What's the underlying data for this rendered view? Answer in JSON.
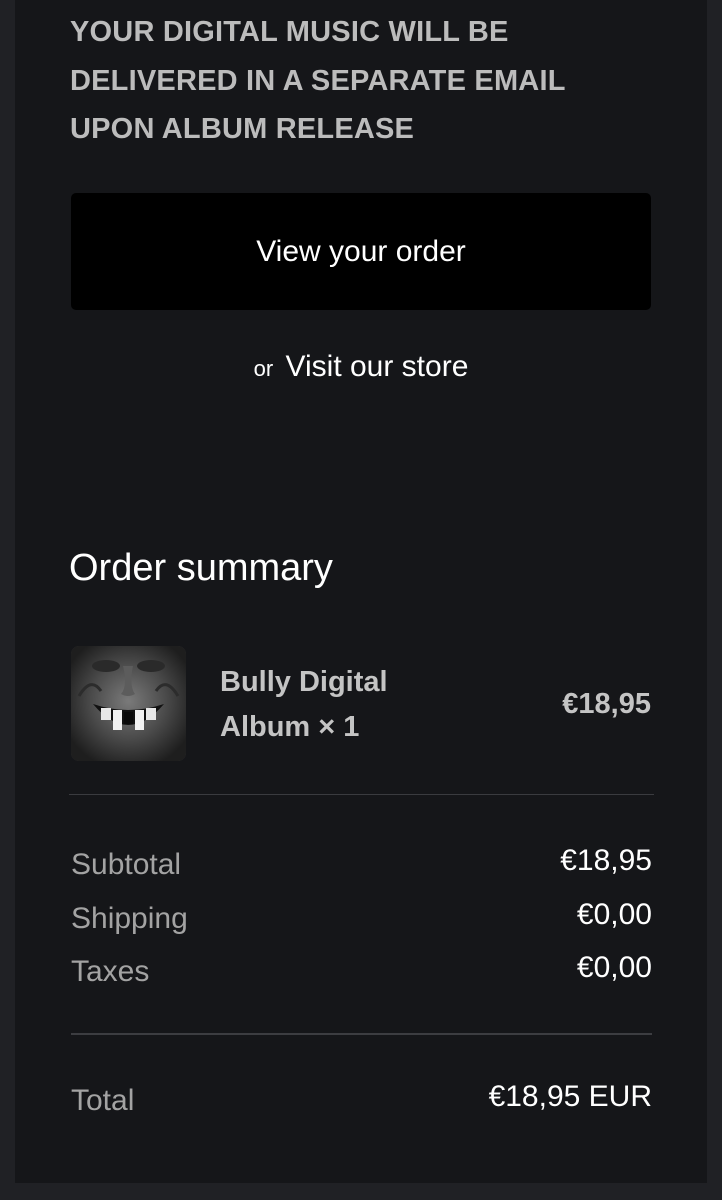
{
  "notice": {
    "text": "YOUR DIGITAL MUSIC WILL BE DELIVERED IN A SEPARATE EMAIL UPON ALBUM RELEASE"
  },
  "actions": {
    "view_order_label": "View your order",
    "or_text": "or",
    "visit_store_label": "Visit our store"
  },
  "summary": {
    "title": "Order summary",
    "item": {
      "name": "Bully Digital Album × 1",
      "price": "€18,95",
      "thumbnail": "album-cover-grinning-face"
    },
    "subtotal": {
      "label": "Subtotal",
      "value": "€18,95"
    },
    "shipping": {
      "label": "Shipping",
      "value": "€0,00"
    },
    "taxes": {
      "label": "Taxes",
      "value": "€0,00"
    },
    "total": {
      "label": "Total",
      "value": "€18,95 EUR"
    }
  },
  "colors": {
    "page_background": "#202125",
    "card_background": "#151619",
    "button_background": "#000000",
    "muted_text": "#a3a3a3",
    "notice_text": "#bcbcbc"
  }
}
